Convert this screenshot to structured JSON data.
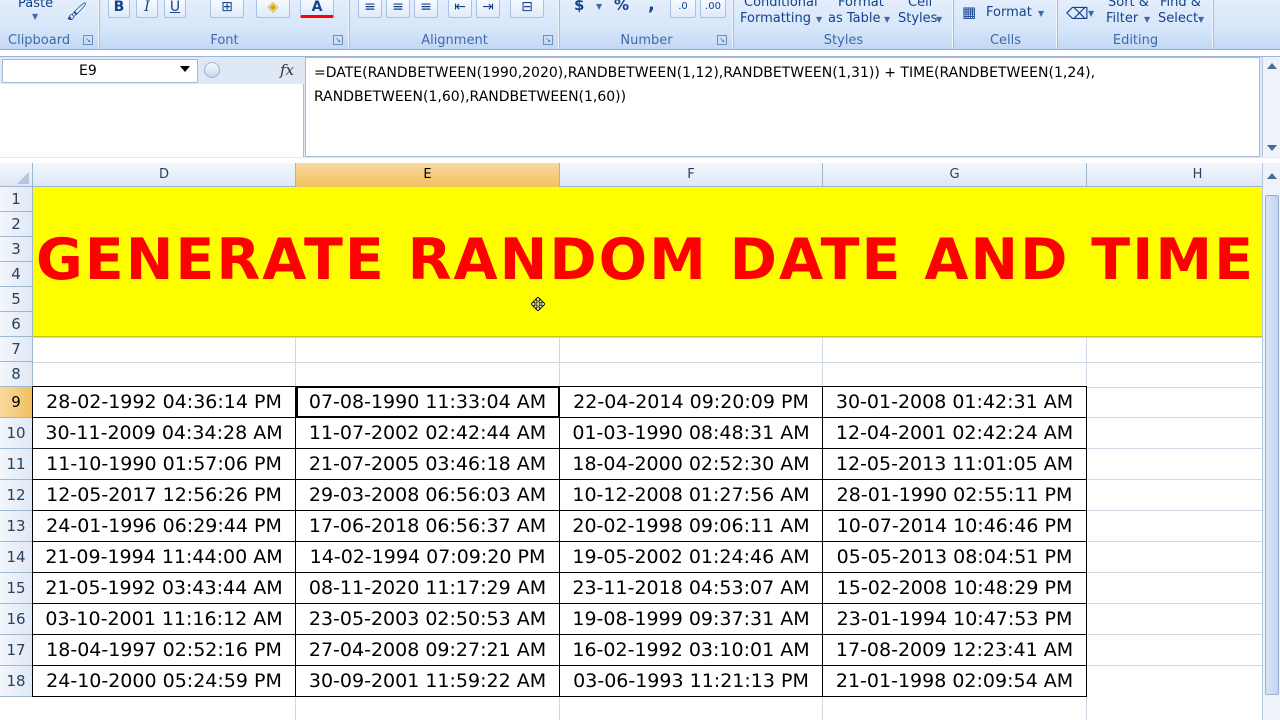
{
  "ribbon": {
    "clipboard": {
      "label": "Clipboard",
      "paste_label": "Paste"
    },
    "font": {
      "label": "Font",
      "bold": "B",
      "italic": "I",
      "underline": "U"
    },
    "alignment": {
      "label": "Alignment"
    },
    "number": {
      "label": "Number",
      "currency": "$",
      "percent": "%",
      "comma": ","
    },
    "styles": {
      "label": "Styles",
      "conditional_formatting_line1": "Conditional",
      "conditional_formatting_line2": "Formatting",
      "format_as_table_line1": "Format",
      "format_as_table_line2": "as Table",
      "cell_styles_line1": "Cell",
      "cell_styles_line2": "Styles"
    },
    "cells": {
      "label": "Cells",
      "format": "Format"
    },
    "editing": {
      "label": "Editing",
      "sort_filter_line1": "Sort &",
      "sort_filter_line2": "Filter",
      "find_select_line1": "Find &",
      "find_select_line2": "Select"
    }
  },
  "formula_bar": {
    "name_box": "E9",
    "fx": "fx",
    "formula_line1": "=DATE(RANDBETWEEN(1990,2020),RANDBETWEEN(1,12),RANDBETWEEN(1,31)) + TIME(RANDBETWEEN(1,24),",
    "formula_line2": "RANDBETWEEN(1,60),RANDBETWEEN(1,60))"
  },
  "sheet": {
    "columns": [
      "D",
      "E",
      "F",
      "G",
      "H"
    ],
    "active_column": "E",
    "active_row": "9",
    "row_numbers": [
      "1",
      "2",
      "3",
      "4",
      "5",
      "6",
      "7",
      "8",
      "9",
      "10",
      "11",
      "12",
      "13",
      "14",
      "15",
      "16",
      "17",
      "18"
    ],
    "banner": "GENERATE RANDOM DATE AND TIME",
    "rows": [
      [
        "28-02-1992 04:36:14 PM",
        "07-08-1990 11:33:04 AM",
        "22-04-2014 09:20:09 PM",
        "30-01-2008 01:42:31 AM"
      ],
      [
        "30-11-2009 04:34:28 AM",
        "11-07-2002 02:42:44 AM",
        "01-03-1990 08:48:31 AM",
        "12-04-2001 02:42:24 AM"
      ],
      [
        "11-10-1990 01:57:06 PM",
        "21-07-2005 03:46:18 AM",
        "18-04-2000 02:52:30 AM",
        "12-05-2013 11:01:05 AM"
      ],
      [
        "12-05-2017 12:56:26 PM",
        "29-03-2008 06:56:03 AM",
        "10-12-2008 01:27:56 AM",
        "28-01-1990 02:55:11 PM"
      ],
      [
        "24-01-1996 06:29:44 PM",
        "17-06-2018 06:56:37 AM",
        "20-02-1998 09:06:11 AM",
        "10-07-2014 10:46:46 PM"
      ],
      [
        "21-09-1994 11:44:00 AM",
        "14-02-1994 07:09:20 PM",
        "19-05-2002 01:24:46 AM",
        "05-05-2013 08:04:51 PM"
      ],
      [
        "21-05-1992 03:43:44 AM",
        "08-11-2020 11:17:29 AM",
        "23-11-2018 04:53:07 AM",
        "15-02-2008 10:48:29 PM"
      ],
      [
        "03-10-2001 11:16:12 AM",
        "23-05-2003 02:50:53 AM",
        "19-08-1999 09:37:31 AM",
        "23-01-1994 10:47:53 PM"
      ],
      [
        "18-04-1997 02:52:16 PM",
        "27-04-2008 09:27:21 AM",
        "16-02-1992 03:10:01 AM",
        "17-08-2009 12:23:41 AM"
      ],
      [
        "24-10-2000 05:24:59 PM",
        "30-09-2001 11:59:22 AM",
        "03-06-1993 11:21:13 PM",
        "21-01-1998 02:09:54 AM"
      ]
    ]
  },
  "colors": {
    "banner_bg": "#ffff00",
    "banner_text": "#ff0000",
    "active_header": "#f1c15f"
  }
}
